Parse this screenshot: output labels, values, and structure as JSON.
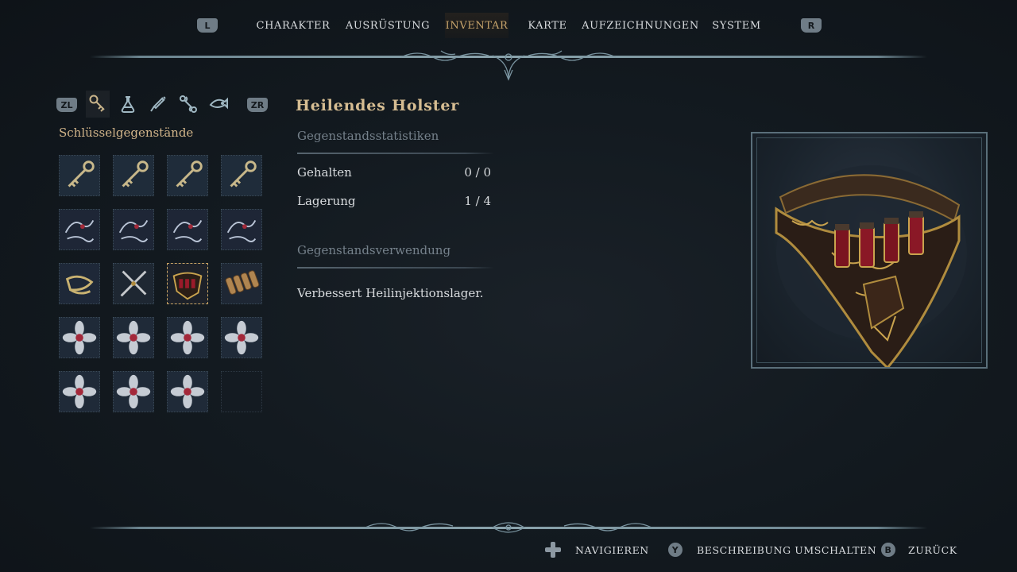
{
  "nav": {
    "left_button": "L",
    "right_button": "R",
    "tabs": [
      {
        "label": "CHARAKTER"
      },
      {
        "label": "AUSRÜSTUNG"
      },
      {
        "label": "INVENTAR",
        "active": true
      },
      {
        "label": "KARTE"
      },
      {
        "label": "AUFZEICHNUNGEN"
      },
      {
        "label": "SYSTEM"
      }
    ]
  },
  "categories": {
    "left_button": "ZL",
    "right_button": "ZR",
    "icons": [
      "key-icon",
      "flask-icon",
      "syringe-icon",
      "bone-icon",
      "fish-icon"
    ],
    "active_index": 0,
    "active_label": "Schlüsselgegenstände"
  },
  "grid": {
    "rows": 5,
    "cols": 4,
    "selected_index": 10,
    "items": [
      "key-item-icon",
      "key-item-icon",
      "key-item-icon",
      "key-item-icon",
      "creature-item-icon",
      "creature-item-icon",
      "creature-item-icon",
      "creature-item-icon",
      "scroll-item-icon",
      "blades-item-icon",
      "holster-item-icon",
      "ammo-belt-item-icon",
      "flower-item-icon",
      "flower-item-icon",
      "flower-item-icon",
      "flower-item-icon",
      "flower-item-icon",
      "flower-item-icon",
      "flower-item-icon",
      "empty-slot"
    ]
  },
  "details": {
    "title": "Heilendes Holster",
    "stats_heading": "Gegenstandsstatistiken",
    "stats": [
      {
        "label": "Gehalten",
        "value": "0 / 0"
      },
      {
        "label": "Lagerung",
        "value": "1 / 4"
      }
    ],
    "usage_heading": "Gegenstandsverwendung",
    "usage_text": "Verbessert Heilinjektionslager."
  },
  "footer": {
    "hints": [
      {
        "glyph": "dpad-icon",
        "label": "NAVIGIEREN"
      },
      {
        "glyph": "Y",
        "label": "BESCHREIBUNG UMSCHALTEN"
      },
      {
        "glyph": "B",
        "label": "ZURÜCK"
      }
    ]
  },
  "colors": {
    "accent_gold": "#c7a46b",
    "text": "#d9dcdf",
    "muted": "#75818b",
    "frame": "#5a6f7a"
  }
}
